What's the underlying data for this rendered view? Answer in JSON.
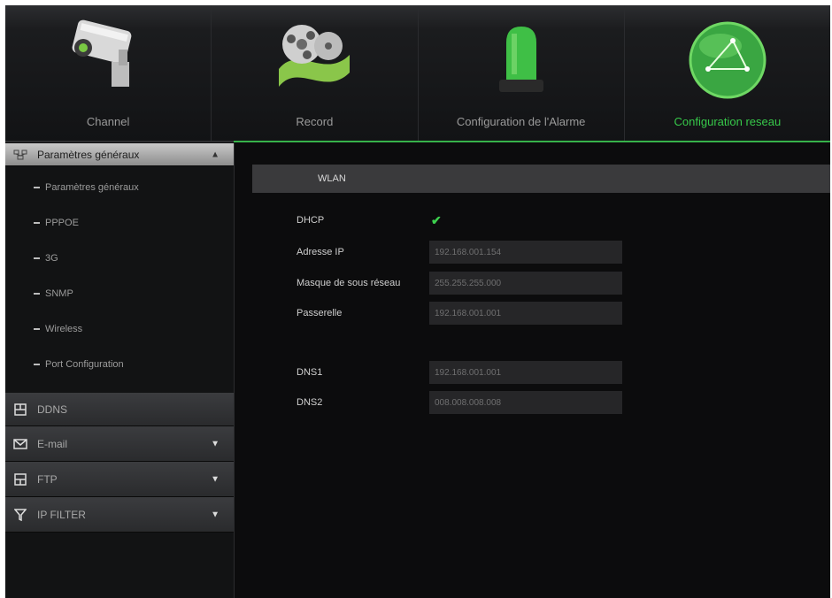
{
  "topnav": {
    "tabs": [
      {
        "label": "Channel",
        "icon": "camera-icon",
        "active": false
      },
      {
        "label": "Record",
        "icon": "film-reel-icon",
        "active": false
      },
      {
        "label": "Configuration de l'Alarme",
        "icon": "alarm-beacon-icon",
        "active": false
      },
      {
        "label": "Configuration reseau",
        "icon": "network-globe-icon",
        "active": true
      }
    ]
  },
  "sidebar": {
    "general": {
      "label": "Paramètres généraux",
      "icon": "network-icon",
      "subitems": [
        "Paramètres généraux",
        "PPPOE",
        "3G",
        "SNMP",
        "Wireless",
        "Port Configuration"
      ]
    },
    "ddns": {
      "label": "DDNS",
      "icon": "ddns-icon"
    },
    "email": {
      "label": "E-mail",
      "icon": "envelope-icon"
    },
    "ftp": {
      "label": "FTP",
      "icon": "ftp-icon"
    },
    "ipfilter": {
      "label": "IP FILTER",
      "icon": "filter-icon"
    }
  },
  "main": {
    "section_title": "WLAN",
    "dhcp_label": "DHCP",
    "dhcp_checked": true,
    "ip_label": "Adresse IP",
    "ip_value": "192.168.001.154",
    "mask_label": "Masque de sous réseau",
    "mask_value": "255.255.255.000",
    "gateway_label": "Passerelle",
    "gateway_value": "192.168.001.001",
    "dns1_label": "DNS1",
    "dns1_value": "192.168.001.001",
    "dns2_label": "DNS2",
    "dns2_value": "008.008.008.008"
  },
  "colors": {
    "accent_green": "#37c94a",
    "background": "#0c0c0d"
  }
}
